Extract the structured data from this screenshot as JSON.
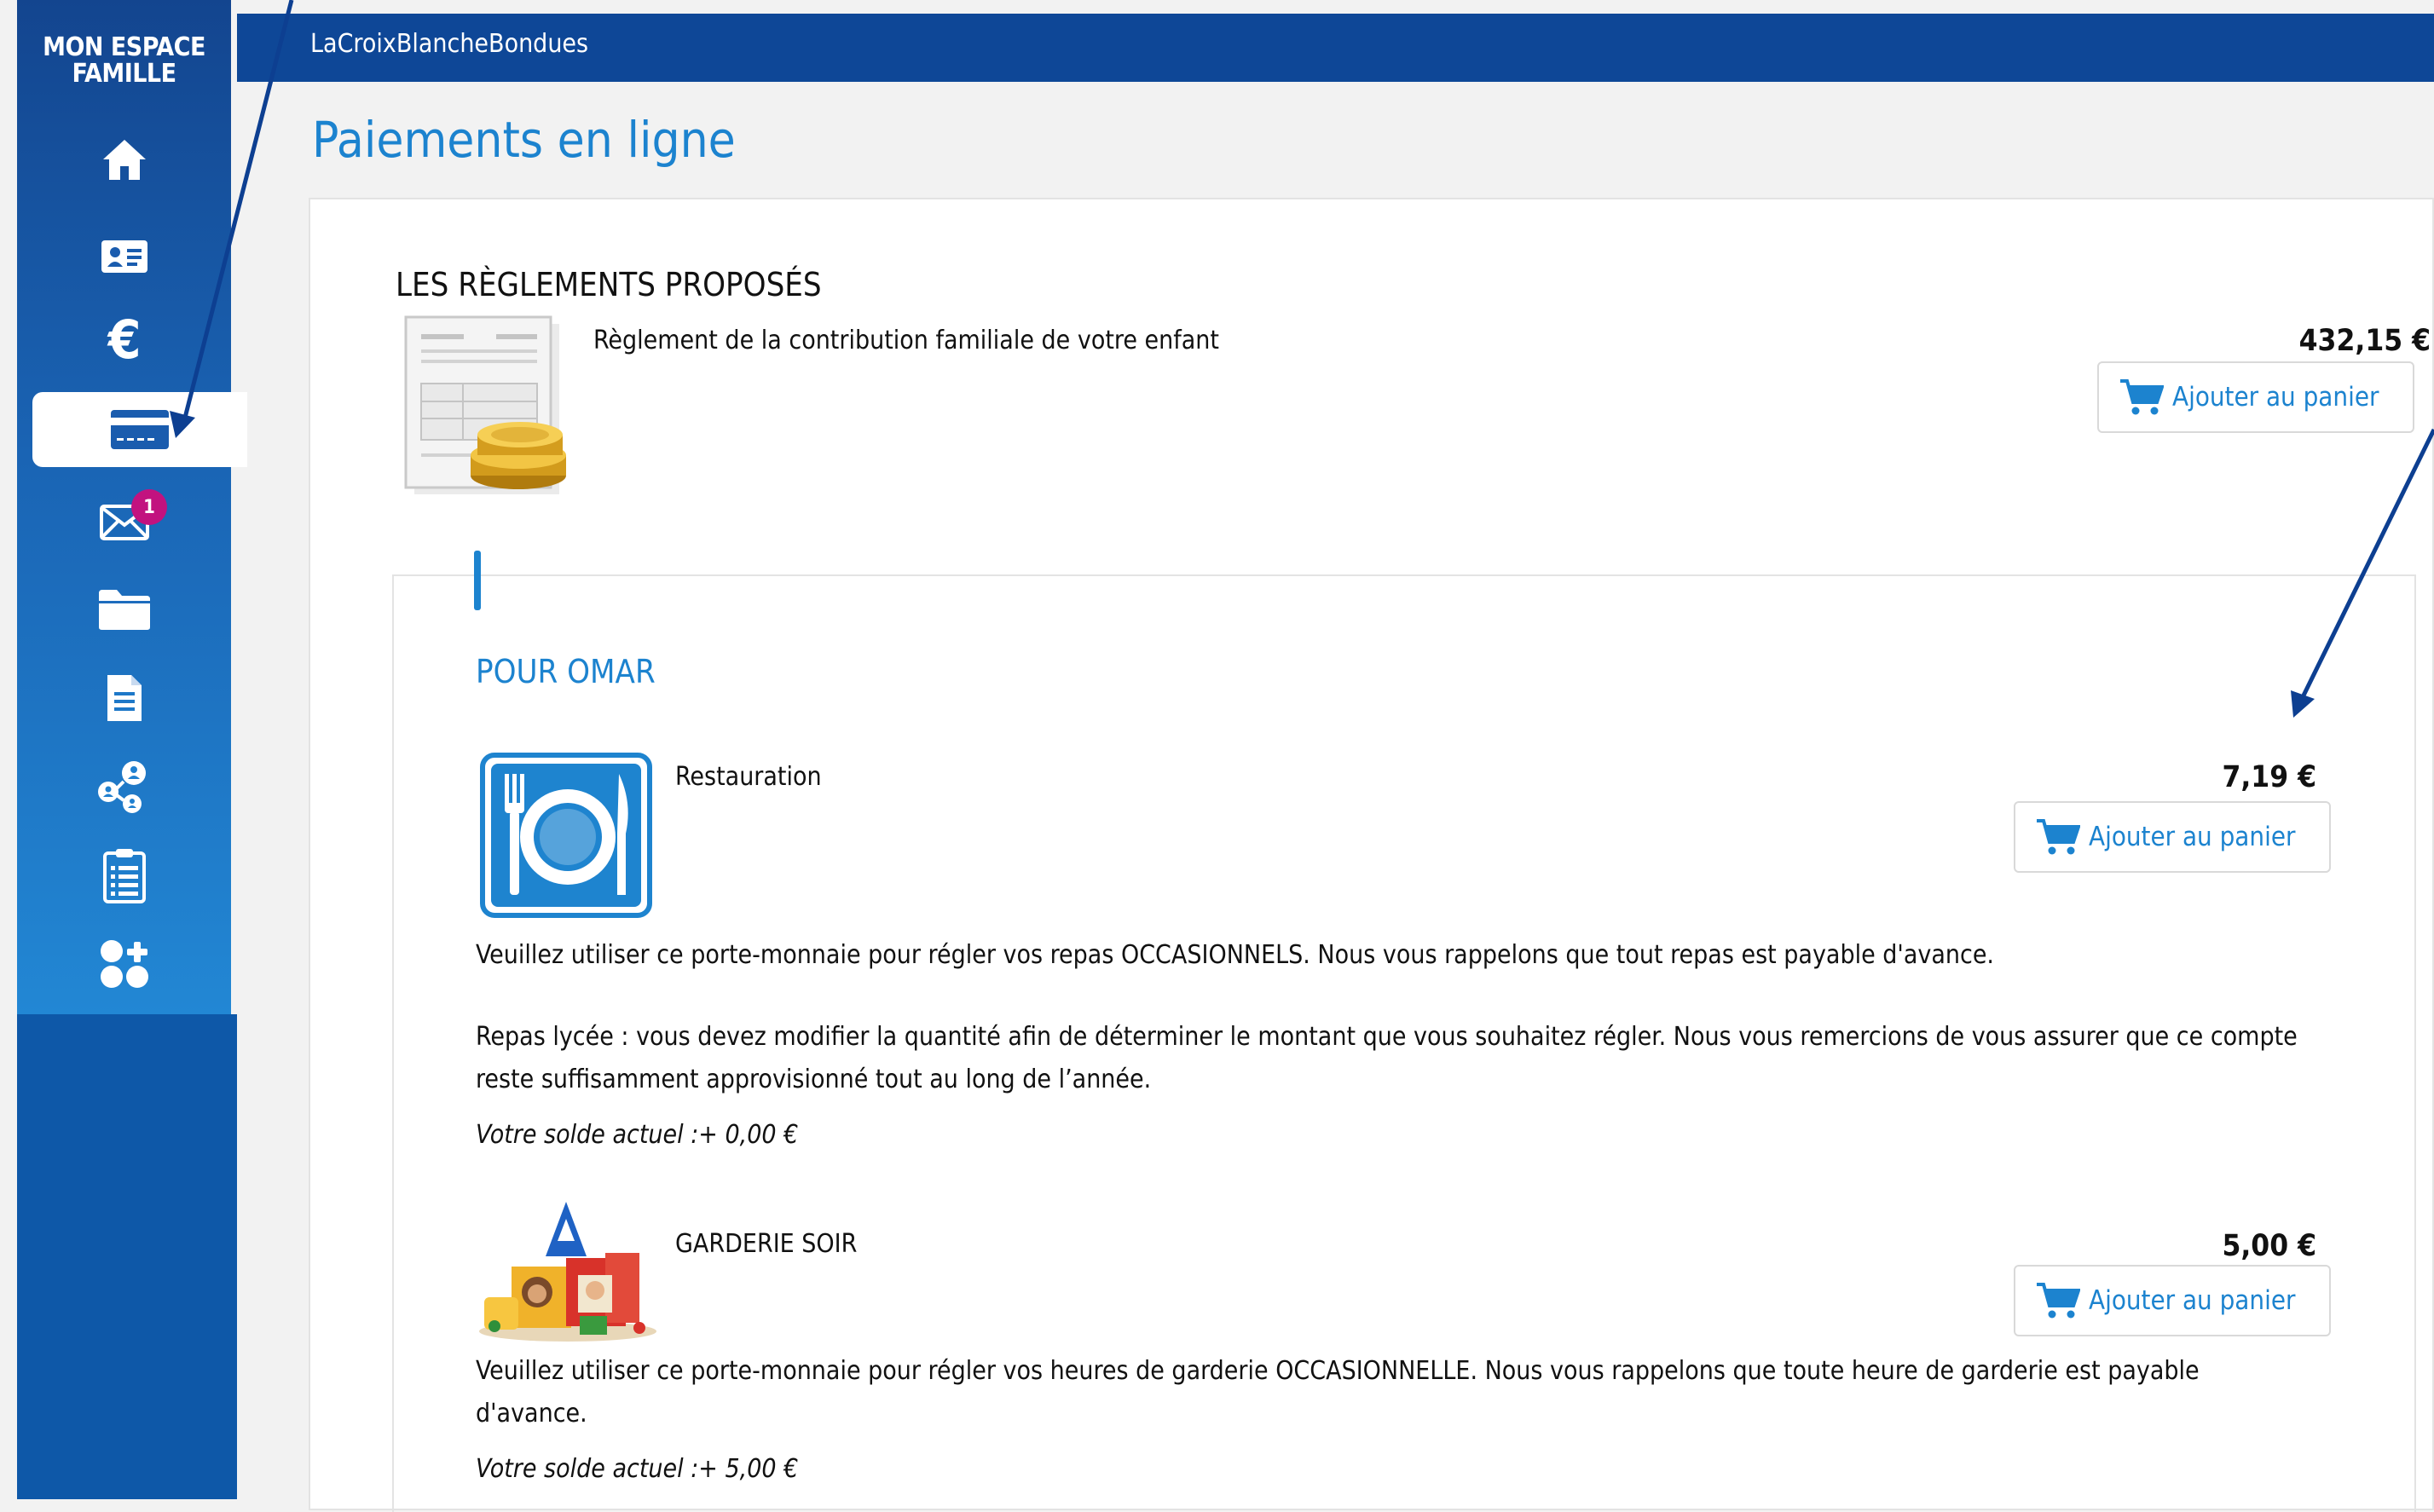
{
  "sidebar": {
    "brand_line1": "MON ESPACE",
    "brand_line2": "FAMILLE",
    "items": [
      {
        "icon": "home-icon"
      },
      {
        "icon": "id-card-icon"
      },
      {
        "icon": "euro-icon"
      },
      {
        "icon": "credit-card-icon",
        "active": true
      },
      {
        "icon": "mail-icon",
        "badge": "1"
      },
      {
        "icon": "folder-icon"
      },
      {
        "icon": "document-icon"
      },
      {
        "icon": "network-icon"
      },
      {
        "icon": "clipboard-icon"
      },
      {
        "icon": "apps-add-icon"
      }
    ],
    "mail_badge": "1"
  },
  "header": {
    "site_name": "LaCroixBlancheBondues"
  },
  "page": {
    "title": "Paiements en ligne"
  },
  "proposed": {
    "heading": "LES RÈGLEMENTS PROPOSÉS",
    "label": "Règlement de la contribution familiale de votre enfant",
    "price": "432,15 €",
    "button": "Ajouter au panier"
  },
  "child": {
    "name": "POUR OMAR",
    "items": [
      {
        "title": "Restauration",
        "price": "7,19 €",
        "button": "Ajouter au panier",
        "desc1": "Veuillez utiliser ce porte-monnaie pour régler vos repas OCCASIONNELS. Nous vous rappelons que tout repas est payable d'avance.",
        "desc2": "Repas lycée : vous devez modifier la quantité afin de déterminer le montant que vous souhaitez régler. Nous vous remercions de vous assurer que ce compte reste suffisamment approvisionné tout au long de l’année.",
        "balance": "Votre solde actuel :+ 0,00 €"
      },
      {
        "title": "GARDERIE SOIR",
        "price": "5,00 €",
        "button": "Ajouter au panier",
        "desc1": "Veuillez utiliser ce porte-monnaie pour régler vos heures de garderie OCCASIONNELLE. Nous vous rappelons que toute heure de garderie est payable d'avance.",
        "balance": "Votre solde actuel :+ 5,00 €"
      }
    ]
  },
  "colors": {
    "accent": "#1c83cf",
    "topbar": "#0e4797",
    "badge": "#c2127f",
    "annotation_arrow": "#0d3f91"
  }
}
